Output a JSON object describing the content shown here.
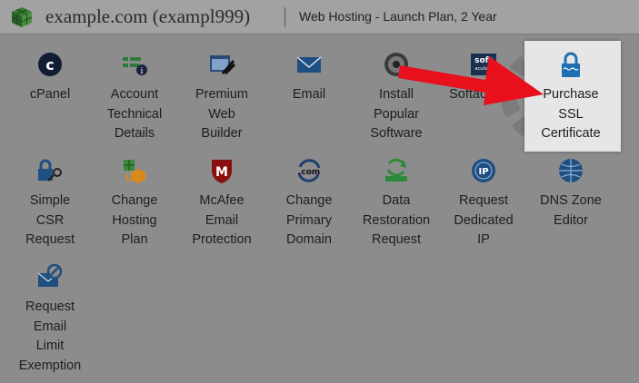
{
  "header": {
    "domain": "example.com (exampl999)",
    "plan": "Web Hosting - Launch Plan, 2 Year"
  },
  "tiles": [
    {
      "lines": [
        "cPanel"
      ],
      "icon": "cpanel-icon"
    },
    {
      "lines": [
        "Account",
        "Technical",
        "Details"
      ],
      "icon": "account-details-icon"
    },
    {
      "lines": [
        "Premium",
        "Web",
        "Builder"
      ],
      "icon": "web-builder-icon"
    },
    {
      "lines": [
        "Email"
      ],
      "icon": "envelope-icon"
    },
    {
      "lines": [
        "Install",
        "Popular",
        "Software"
      ],
      "icon": "install-software-icon"
    },
    {
      "lines": [
        "Softaculous"
      ],
      "icon": "softaculous-icon"
    },
    {
      "lines": [
        "Purchase",
        "SSL",
        "Certificate"
      ],
      "icon": "ssl-lock-icon"
    },
    {
      "lines": [
        "Simple",
        "CSR",
        "Request"
      ],
      "icon": "csr-lock-key-icon"
    },
    {
      "lines": [
        "Change",
        "Hosting",
        "Plan"
      ],
      "icon": "change-plan-icon"
    },
    {
      "lines": [
        "McAfee",
        "Email",
        "Protection"
      ],
      "icon": "mcafee-shield-icon"
    },
    {
      "lines": [
        "Change",
        "Primary",
        "Domain"
      ],
      "icon": "change-domain-icon"
    },
    {
      "lines": [
        "Data",
        "Restoration",
        "Request"
      ],
      "icon": "data-restore-icon"
    },
    {
      "lines": [
        "Request",
        "Dedicated",
        "IP"
      ],
      "icon": "dedicated-ip-icon"
    },
    {
      "lines": [
        "DNS Zone",
        "Editor"
      ],
      "icon": "dns-globe-icon"
    },
    {
      "lines": [
        "Request",
        "Email",
        "Limit",
        "Exemption"
      ],
      "icon": "email-limit-icon"
    }
  ],
  "colors": {
    "page_overlay": "#8c8c8c",
    "highlight": "#e6e6e6",
    "arrow": "#e8101c",
    "icon_blue": "#1f4f80"
  }
}
